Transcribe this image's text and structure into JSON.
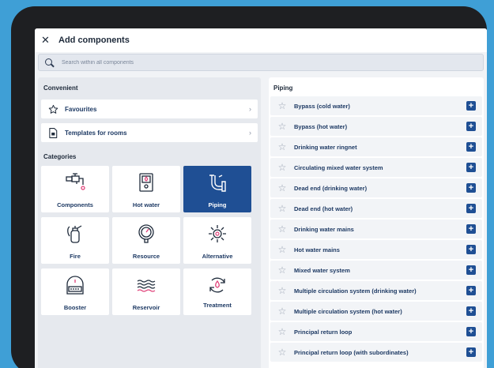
{
  "header": {
    "title": "Add components",
    "close_icon": "close-icon"
  },
  "search": {
    "placeholder": "Search within all components"
  },
  "convenient": {
    "label": "Convenient",
    "items": [
      {
        "label": "Favourites",
        "icon": "star-icon"
      },
      {
        "label": "Templates for rooms",
        "icon": "template-icon"
      }
    ]
  },
  "categories": {
    "label": "Categories",
    "items": [
      {
        "label": "Components",
        "icon": "tap-icon",
        "active": false
      },
      {
        "label": "Hot water",
        "icon": "boiler-icon",
        "active": false
      },
      {
        "label": "Piping",
        "icon": "pipe-icon",
        "active": true
      },
      {
        "label": "Fire",
        "icon": "extinguisher-icon",
        "active": false
      },
      {
        "label": "Resource",
        "icon": "gauge-icon",
        "active": false
      },
      {
        "label": "Alternative",
        "icon": "gear-icon",
        "active": false
      },
      {
        "label": "Booster",
        "icon": "booster-icon",
        "active": false
      },
      {
        "label": "Reservoir",
        "icon": "waves-icon",
        "active": false
      },
      {
        "label": "Treatment",
        "icon": "water-drop-icon",
        "active": false
      }
    ]
  },
  "piping": {
    "label": "Piping",
    "items": [
      "Bypass (cold water)",
      "Bypass (hot water)",
      "Drinking water ringnet",
      "Circulating mixed water system",
      "Dead end (drinking water)",
      "Dead end (hot water)",
      "Drinking water mains",
      "Hot water mains",
      "Mixed water system",
      "Multiple circulation system (drinking water)",
      "Multiple circulation system (hot water)",
      "Principal return loop",
      "Principal return loop (with subordinates)"
    ]
  },
  "colors": {
    "accent": "#1f4f94",
    "background": "#3f9fd6"
  }
}
